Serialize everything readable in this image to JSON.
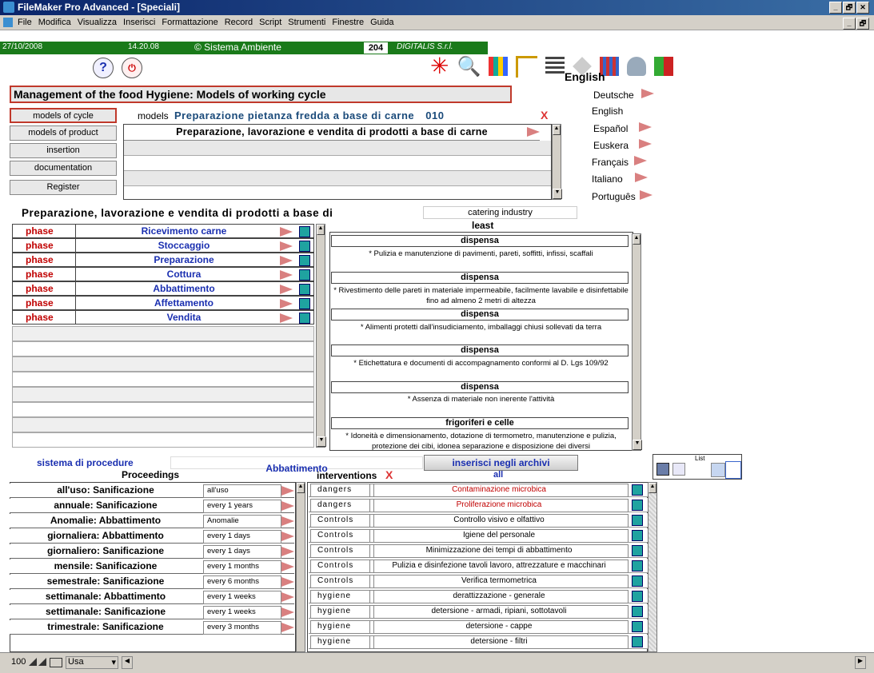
{
  "window": {
    "title": "FileMaker Pro Advanced - [Speciali]",
    "minimize": "_",
    "restore": "🗗",
    "close": "✕"
  },
  "menu": [
    "File",
    "Modifica",
    "Visualizza",
    "Inserisci",
    "Formattazione",
    "Record",
    "Script",
    "Strumenti",
    "Finestre",
    "Guida"
  ],
  "status": {
    "date": "27/10/2008",
    "time": "14.20.08",
    "copyright": "© Sistema Ambiente",
    "record": "204",
    "brand": "DIGITALIS S.r.l."
  },
  "toolbar": {
    "help": "?",
    "current_language": "English"
  },
  "header": {
    "title": "Management of the food Hygiene: Models of working cycle"
  },
  "nav": [
    {
      "label": "models of cycle",
      "active": true
    },
    {
      "label": "models of product"
    },
    {
      "label": "insertion"
    },
    {
      "label": "documentation"
    },
    {
      "label": "Register"
    }
  ],
  "models": {
    "label": "models",
    "name": "Preparazione pietanza fredda a base di carne",
    "code": "010",
    "delete": "X",
    "cycle": "Preparazione, lavorazione e vendita di prodotti a base di carne"
  },
  "languages": [
    "Deutsche",
    "English",
    "Español",
    "Euskera",
    "Français",
    "Italiano",
    "Português"
  ],
  "section": {
    "title": "Preparazione, lavorazione e vendita di prodotti a base di",
    "industry": "catering industry",
    "least": "least"
  },
  "phases": [
    {
      "type": "phase",
      "name": "Ricevimento carne"
    },
    {
      "type": "phase",
      "name": "Stoccaggio"
    },
    {
      "type": "phase",
      "name": "Preparazione"
    },
    {
      "type": "phase",
      "name": "Cottura"
    },
    {
      "type": "phase",
      "name": "Abbattimento"
    },
    {
      "type": "phase",
      "name": "Affettamento"
    },
    {
      "type": "phase",
      "name": "Vendita"
    }
  ],
  "least": [
    {
      "head": "dispensa",
      "desc": "* Pulizia e manutenzione di pavimenti, pareti, soffitti, infissi, scaffali"
    },
    {
      "head": "dispensa",
      "desc": "* Rivestimento delle pareti in materiale impermeabile, facilmente lavabile e disinfettabile fino ad almeno 2 metri di altezza"
    },
    {
      "head": "dispensa",
      "desc": "* Alimenti protetti dall'insudiciamento, imballaggi chiusi sollevati da terra"
    },
    {
      "head": "dispensa",
      "desc": "* Etichettatura e documenti di accompagnamento conformi al D. Lgs 109/92"
    },
    {
      "head": "dispensa",
      "desc": "* Assenza di materiale non inerente l'attività"
    },
    {
      "head": "frigoriferi e celle",
      "desc": "* Idoneità e dimensionamento, dotazione di termometro, manutenzione e pulizia, protezione dei cibi, idonea separazione e disposizione dei diversi"
    }
  ],
  "procedures": {
    "system": "sistema di procedure",
    "selected": "Abbattimento",
    "archive_button": "inserisci negli archivi",
    "list_label": "List",
    "proceedings_header": "Proceedings",
    "interventions_header": "interventions",
    "all": "all",
    "delete": "X",
    "rows": [
      {
        "name": "all'uso: Sanificazione",
        "freq": "all'uso"
      },
      {
        "name": "annuale: Sanificazione",
        "freq": "every 1 years"
      },
      {
        "name": "Anomalie: Abbattimento",
        "freq": "Anomalie"
      },
      {
        "name": "giornaliera: Abbattimento",
        "freq": "every 1 days"
      },
      {
        "name": "giornaliero: Sanificazione",
        "freq": "every 1 days"
      },
      {
        "name": "mensile: Sanificazione",
        "freq": "every 1 months"
      },
      {
        "name": "semestrale: Sanificazione",
        "freq": "every 6 months"
      },
      {
        "name": "settimanale: Abbattimento",
        "freq": "every 1 weeks"
      },
      {
        "name": "settimanale: Sanificazione",
        "freq": "every 1 weeks"
      },
      {
        "name": "trimestrale: Sanificazione",
        "freq": "every 3 months"
      }
    ],
    "interventions": [
      {
        "cat": "dangers",
        "desc": "Contaminazione microbica",
        "red": true
      },
      {
        "cat": "dangers",
        "desc": "Proliferazione microbica",
        "red": true
      },
      {
        "cat": "Controls",
        "desc": "Controllo visivo e olfattivo"
      },
      {
        "cat": "Controls",
        "desc": "Igiene del personale"
      },
      {
        "cat": "Controls",
        "desc": "Minimizzazione dei tempi di abbattimento"
      },
      {
        "cat": "Controls",
        "desc": "Pulizia e disinfezione tavoli lavoro, attrezzature e macchinari"
      },
      {
        "cat": "Controls",
        "desc": "Verifica termometrica"
      },
      {
        "cat": "hygiene",
        "desc": "derattizzazione - generale"
      },
      {
        "cat": "hygiene",
        "desc": "detersione - armadi, ripiani, sottotavoli"
      },
      {
        "cat": "hygiene",
        "desc": "detersione - cappe"
      },
      {
        "cat": "hygiene",
        "desc": "detersione - filtri"
      }
    ]
  },
  "bottombar": {
    "zoom": "100",
    "mode": "Usa"
  },
  "colors": {
    "accent_red": "#c0392b",
    "phase_blue": "#1a2fb0",
    "status_green": "#1a7a1a"
  }
}
